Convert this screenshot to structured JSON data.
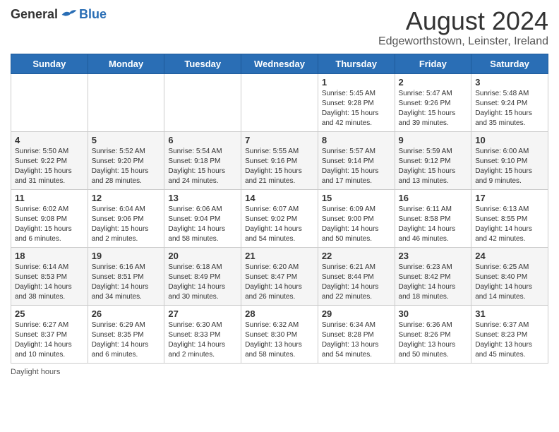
{
  "header": {
    "logo_general": "General",
    "logo_blue": "Blue",
    "month_title": "August 2024",
    "location": "Edgeworthstown, Leinster, Ireland"
  },
  "days_of_week": [
    "Sunday",
    "Monday",
    "Tuesday",
    "Wednesday",
    "Thursday",
    "Friday",
    "Saturday"
  ],
  "footer": {
    "note": "Daylight hours"
  },
  "weeks": [
    [
      {
        "day": "",
        "content": ""
      },
      {
        "day": "",
        "content": ""
      },
      {
        "day": "",
        "content": ""
      },
      {
        "day": "",
        "content": ""
      },
      {
        "day": "1",
        "content": "Sunrise: 5:45 AM\nSunset: 9:28 PM\nDaylight: 15 hours\nand 42 minutes."
      },
      {
        "day": "2",
        "content": "Sunrise: 5:47 AM\nSunset: 9:26 PM\nDaylight: 15 hours\nand 39 minutes."
      },
      {
        "day": "3",
        "content": "Sunrise: 5:48 AM\nSunset: 9:24 PM\nDaylight: 15 hours\nand 35 minutes."
      }
    ],
    [
      {
        "day": "4",
        "content": "Sunrise: 5:50 AM\nSunset: 9:22 PM\nDaylight: 15 hours\nand 31 minutes."
      },
      {
        "day": "5",
        "content": "Sunrise: 5:52 AM\nSunset: 9:20 PM\nDaylight: 15 hours\nand 28 minutes."
      },
      {
        "day": "6",
        "content": "Sunrise: 5:54 AM\nSunset: 9:18 PM\nDaylight: 15 hours\nand 24 minutes."
      },
      {
        "day": "7",
        "content": "Sunrise: 5:55 AM\nSunset: 9:16 PM\nDaylight: 15 hours\nand 21 minutes."
      },
      {
        "day": "8",
        "content": "Sunrise: 5:57 AM\nSunset: 9:14 PM\nDaylight: 15 hours\nand 17 minutes."
      },
      {
        "day": "9",
        "content": "Sunrise: 5:59 AM\nSunset: 9:12 PM\nDaylight: 15 hours\nand 13 minutes."
      },
      {
        "day": "10",
        "content": "Sunrise: 6:00 AM\nSunset: 9:10 PM\nDaylight: 15 hours\nand 9 minutes."
      }
    ],
    [
      {
        "day": "11",
        "content": "Sunrise: 6:02 AM\nSunset: 9:08 PM\nDaylight: 15 hours\nand 6 minutes."
      },
      {
        "day": "12",
        "content": "Sunrise: 6:04 AM\nSunset: 9:06 PM\nDaylight: 15 hours\nand 2 minutes."
      },
      {
        "day": "13",
        "content": "Sunrise: 6:06 AM\nSunset: 9:04 PM\nDaylight: 14 hours\nand 58 minutes."
      },
      {
        "day": "14",
        "content": "Sunrise: 6:07 AM\nSunset: 9:02 PM\nDaylight: 14 hours\nand 54 minutes."
      },
      {
        "day": "15",
        "content": "Sunrise: 6:09 AM\nSunset: 9:00 PM\nDaylight: 14 hours\nand 50 minutes."
      },
      {
        "day": "16",
        "content": "Sunrise: 6:11 AM\nSunset: 8:58 PM\nDaylight: 14 hours\nand 46 minutes."
      },
      {
        "day": "17",
        "content": "Sunrise: 6:13 AM\nSunset: 8:55 PM\nDaylight: 14 hours\nand 42 minutes."
      }
    ],
    [
      {
        "day": "18",
        "content": "Sunrise: 6:14 AM\nSunset: 8:53 PM\nDaylight: 14 hours\nand 38 minutes."
      },
      {
        "day": "19",
        "content": "Sunrise: 6:16 AM\nSunset: 8:51 PM\nDaylight: 14 hours\nand 34 minutes."
      },
      {
        "day": "20",
        "content": "Sunrise: 6:18 AM\nSunset: 8:49 PM\nDaylight: 14 hours\nand 30 minutes."
      },
      {
        "day": "21",
        "content": "Sunrise: 6:20 AM\nSunset: 8:47 PM\nDaylight: 14 hours\nand 26 minutes."
      },
      {
        "day": "22",
        "content": "Sunrise: 6:21 AM\nSunset: 8:44 PM\nDaylight: 14 hours\nand 22 minutes."
      },
      {
        "day": "23",
        "content": "Sunrise: 6:23 AM\nSunset: 8:42 PM\nDaylight: 14 hours\nand 18 minutes."
      },
      {
        "day": "24",
        "content": "Sunrise: 6:25 AM\nSunset: 8:40 PM\nDaylight: 14 hours\nand 14 minutes."
      }
    ],
    [
      {
        "day": "25",
        "content": "Sunrise: 6:27 AM\nSunset: 8:37 PM\nDaylight: 14 hours\nand 10 minutes."
      },
      {
        "day": "26",
        "content": "Sunrise: 6:29 AM\nSunset: 8:35 PM\nDaylight: 14 hours\nand 6 minutes."
      },
      {
        "day": "27",
        "content": "Sunrise: 6:30 AM\nSunset: 8:33 PM\nDaylight: 14 hours\nand 2 minutes."
      },
      {
        "day": "28",
        "content": "Sunrise: 6:32 AM\nSunset: 8:30 PM\nDaylight: 13 hours\nand 58 minutes."
      },
      {
        "day": "29",
        "content": "Sunrise: 6:34 AM\nSunset: 8:28 PM\nDaylight: 13 hours\nand 54 minutes."
      },
      {
        "day": "30",
        "content": "Sunrise: 6:36 AM\nSunset: 8:26 PM\nDaylight: 13 hours\nand 50 minutes."
      },
      {
        "day": "31",
        "content": "Sunrise: 6:37 AM\nSunset: 8:23 PM\nDaylight: 13 hours\nand 45 minutes."
      }
    ]
  ]
}
